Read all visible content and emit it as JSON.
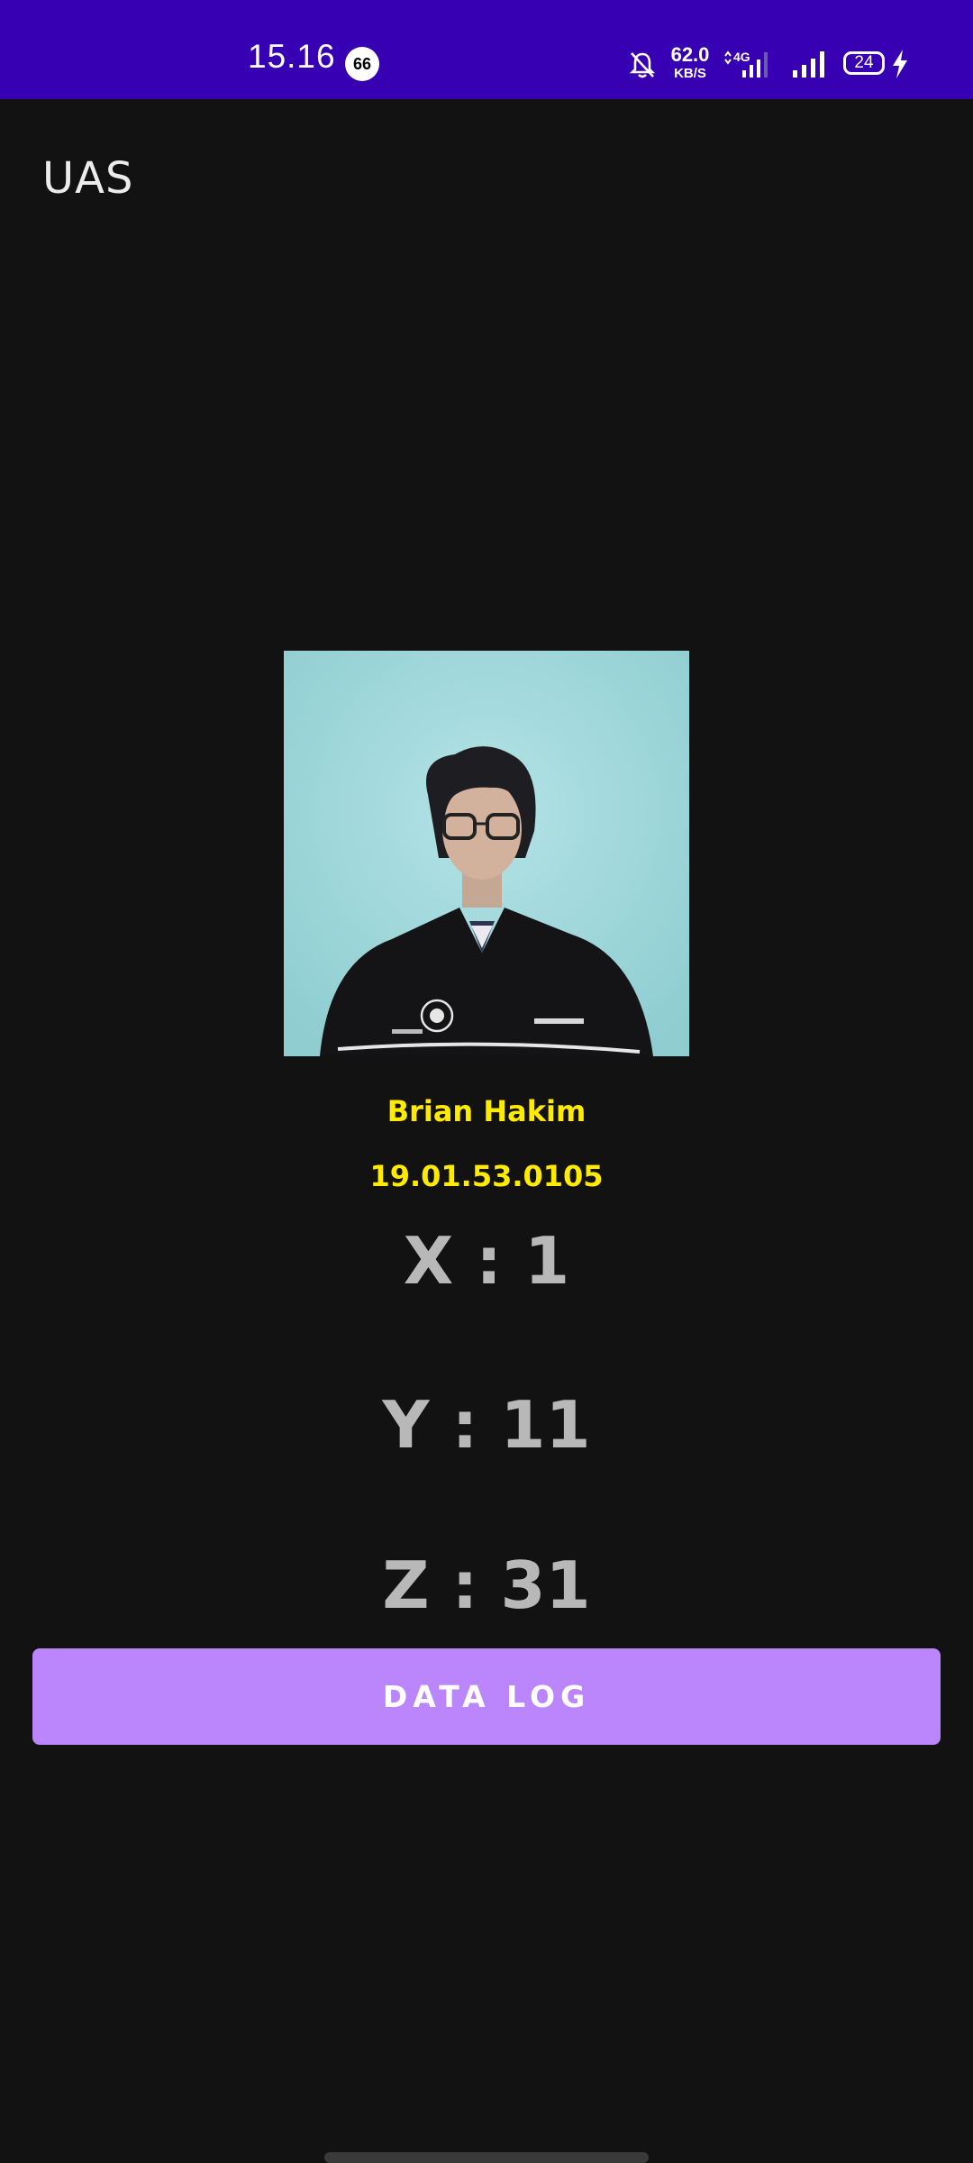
{
  "status_bar": {
    "time": "15.16",
    "notification_count": "66",
    "net_speed_value": "62.0",
    "net_speed_unit": "KB/S",
    "network_type": "4G",
    "battery_level": "24",
    "background_color": "#3700B3"
  },
  "app_bar": {
    "title": "UAS"
  },
  "profile": {
    "name": "Brian Hakim",
    "student_id": "19.01.53.0105",
    "text_color": "#FFEB00"
  },
  "sensor": {
    "x_label": "X : 1",
    "y_label": "Y : 11",
    "z_label": "Z : 31"
  },
  "actions": {
    "data_log_label": "DATA LOG",
    "button_color": "#BB86FC"
  },
  "icons": [
    "notifications-off-icon",
    "network-4g-icon",
    "cell-signal-icon",
    "battery-icon",
    "charging-bolt-icon"
  ]
}
